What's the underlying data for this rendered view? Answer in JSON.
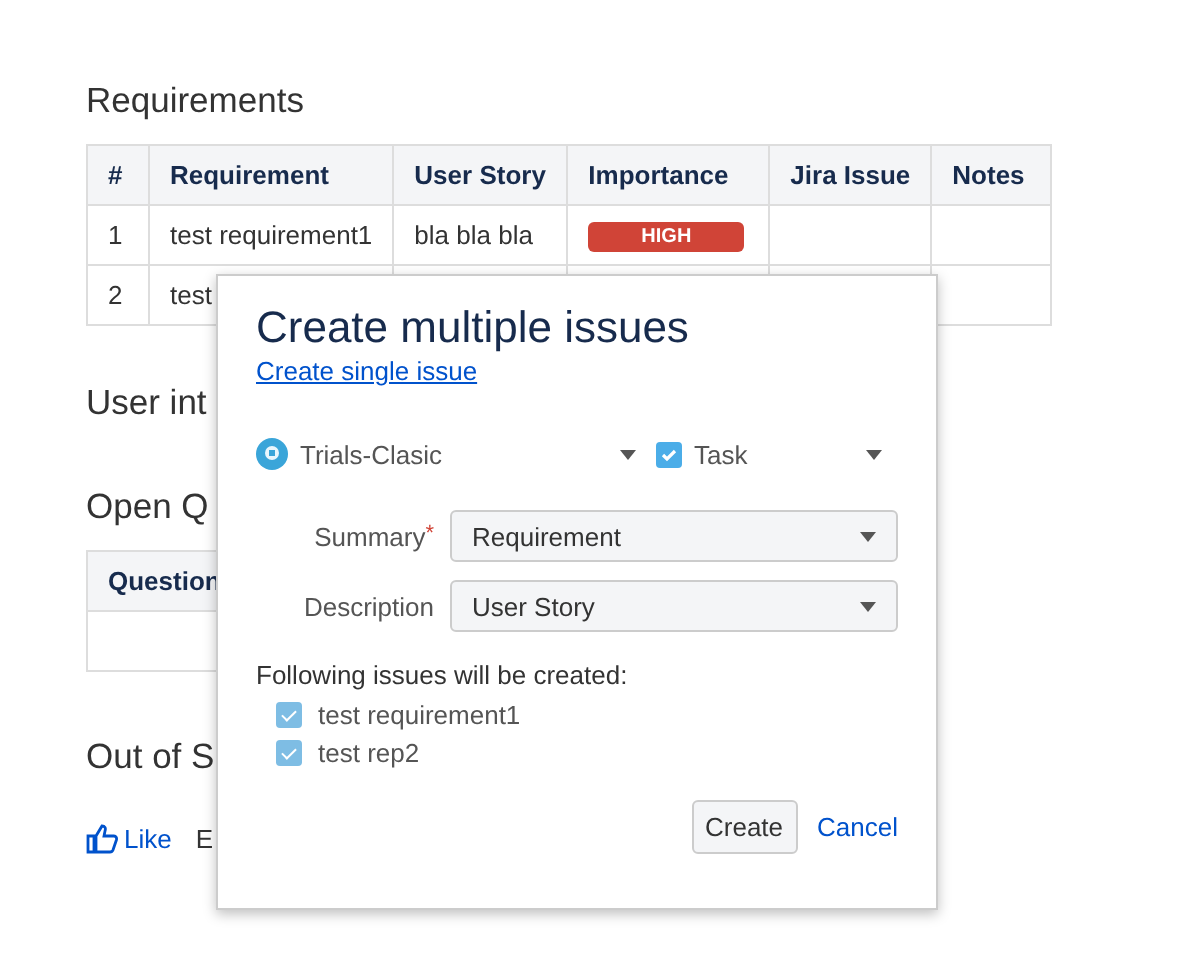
{
  "requirements": {
    "heading": "Requirements",
    "columns": [
      "#",
      "Requirement",
      "User Story",
      "Importance",
      "Jira Issue",
      "Notes"
    ],
    "rows": [
      {
        "number": "1",
        "requirement": "test requirement1",
        "user_story": "bla bla bla",
        "importance": "HIGH"
      },
      {
        "number": "2",
        "requirement": "test"
      }
    ]
  },
  "user_interaction": {
    "heading": "User int"
  },
  "open_questions": {
    "heading": "Open Q",
    "columns": [
      "Question"
    ]
  },
  "out_of_scope": {
    "heading": "Out of S"
  },
  "footer": {
    "like": "Like",
    "column_2": "E"
  },
  "dialog": {
    "title": "Create multiple issues",
    "single_link": "Create single issue",
    "project": "Trials-Clasic",
    "issue_type": "Task",
    "fields": [
      {
        "label": "Summary",
        "required_mark": "*",
        "value": "Requirement"
      },
      {
        "label": "Description",
        "value": "User Story"
      }
    ],
    "list_caption": "Following issues will be created:",
    "issues": [
      {
        "label": "test requirement1",
        "checked": true
      },
      {
        "label": "test rep2",
        "checked": true
      }
    ],
    "create": "Create",
    "cancel": "Cancel"
  }
}
